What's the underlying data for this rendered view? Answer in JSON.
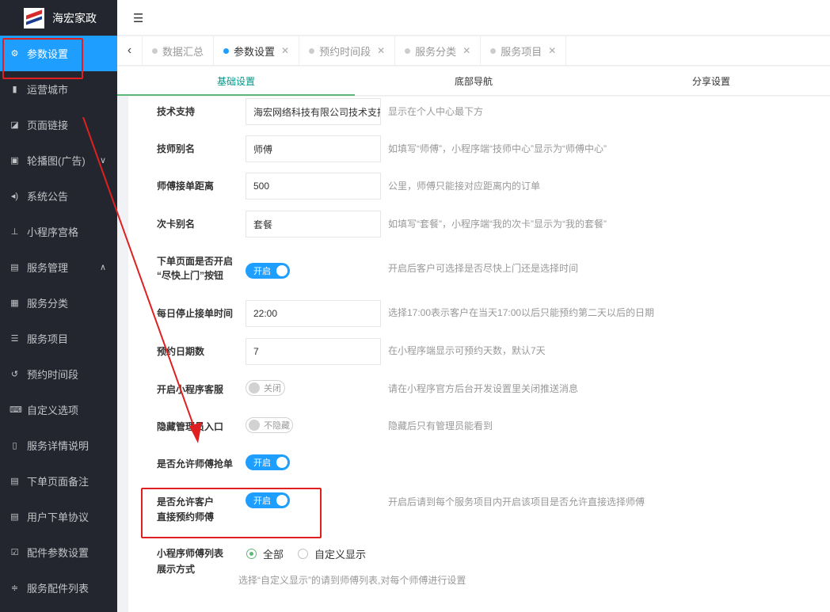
{
  "app": {
    "name": "海宏家政"
  },
  "sidebar": {
    "items": [
      {
        "label": "参数设置",
        "icon": "gear-icon"
      },
      {
        "label": "运营城市",
        "icon": "building-icon"
      },
      {
        "label": "页面链接",
        "icon": "link-icon"
      },
      {
        "label": "轮播图(广告)",
        "icon": "image-icon"
      },
      {
        "label": "系统公告",
        "icon": "speaker-icon"
      },
      {
        "label": "小程序宫格",
        "icon": "sitemap-icon"
      },
      {
        "label": "服务管理",
        "icon": "card-icon"
      },
      {
        "label": "服务分类",
        "icon": "grid-icon"
      },
      {
        "label": "服务项目",
        "icon": "list-icon"
      },
      {
        "label": "预约时间段",
        "icon": "history-icon"
      },
      {
        "label": "自定义选项",
        "icon": "keyboard-icon"
      },
      {
        "label": "服务详情说明",
        "icon": "file-icon"
      },
      {
        "label": "下单页面备注",
        "icon": "note-icon"
      },
      {
        "label": "用户下单协议",
        "icon": "agreement-icon"
      },
      {
        "label": "配件参数设置",
        "icon": "checkbox-icon"
      },
      {
        "label": "服务配件列表",
        "icon": "sliders-icon"
      }
    ]
  },
  "tabs": [
    {
      "label": "数据汇总",
      "closable": false
    },
    {
      "label": "参数设置",
      "closable": true
    },
    {
      "label": "预约时间段",
      "closable": true
    },
    {
      "label": "服务分类",
      "closable": true
    },
    {
      "label": "服务项目",
      "closable": true
    }
  ],
  "subtabs": [
    "基础设置",
    "底部导航",
    "分享设置"
  ],
  "form": {
    "tech_support": {
      "label": "技术支持",
      "value": "海宏网络科技有限公司技术支持",
      "hint": "显示在个人中心最下方"
    },
    "tech_alias": {
      "label": "技师别名",
      "value": "师傅",
      "hint": "如填写“师傅”，小程序端“技师中心”显示为“师傅中心”"
    },
    "distance": {
      "label": "师傅接单距离",
      "value": "500",
      "hint": "公里，师傅只能接对应距离内的订单"
    },
    "card_alias": {
      "label": "次卡别名",
      "value": "套餐",
      "hint": "如填写“套餐”，小程序端“我的次卡”显示为“我的套餐”"
    },
    "asap": {
      "label_line1": "下单页面是否开启",
      "label_line2": "“尽快上门”按钮",
      "switch": "开启",
      "hint": "开启后客户可选择是否尽快上门还是选择时间"
    },
    "stop_time": {
      "label": "每日停止接单时间",
      "value": "22:00",
      "hint": "选择17:00表示客户在当天17:00以后只能预约第二天以后的日期"
    },
    "days": {
      "label": "预约日期数",
      "value": "7",
      "hint": "在小程序端显示可预约天数，默认7天"
    },
    "service": {
      "label": "开启小程序客服",
      "switch": "关闭",
      "hint": "请在小程序官方后台开发设置里关闭推送消息"
    },
    "hide_admin": {
      "label": "隐藏管理员入口",
      "switch": "不隐藏",
      "hint": "隐藏后只有管理员能看到"
    },
    "grab": {
      "label": "是否允许师傅抢单",
      "switch": "开启"
    },
    "direct": {
      "label_line1": "是否允许客户",
      "label_line2": "直接预约师傅",
      "switch": "开启",
      "hint": "开启后请到每个服务项目内开启该项目是否允许直接选择师傅"
    },
    "list_mode": {
      "label_line1": "小程序师傅列表",
      "label_line2": "展示方式",
      "option_all": "全部",
      "option_custom": "自定义显示",
      "hint": "选择“自定义显示”的请到师傅列表,对每个师傅进行设置"
    }
  },
  "colors": {
    "accent": "#1e9fff",
    "sidebar_bg": "#23262e",
    "annotation_red": "#e02020",
    "subtab_active": "#009688"
  }
}
